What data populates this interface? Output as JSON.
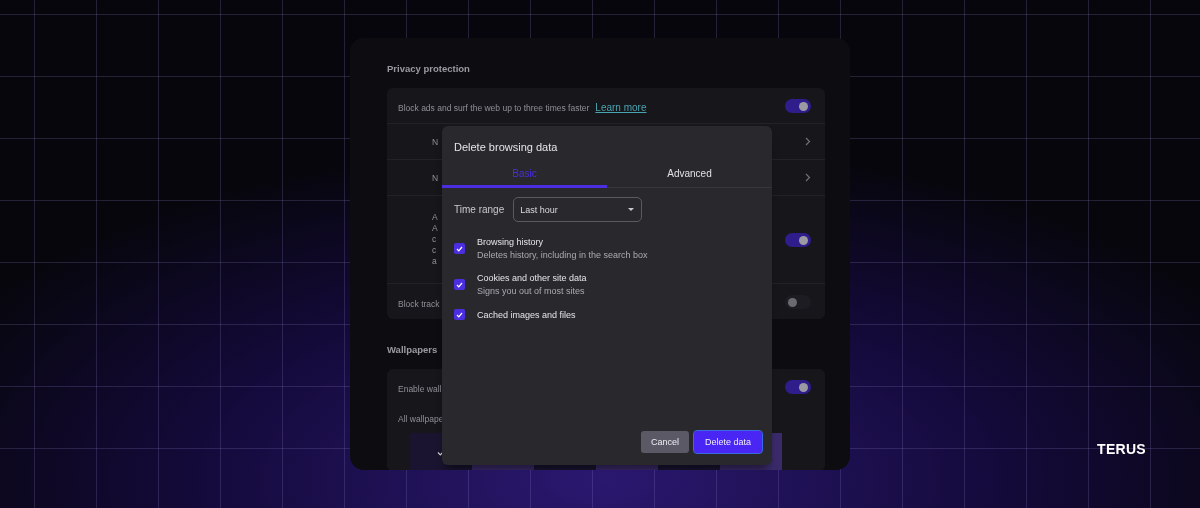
{
  "settings": {
    "sections": [
      {
        "title": "Privacy protection",
        "rows": [
          {
            "kind": "toggle",
            "label": "Block ads and surf the web up to three times faster",
            "link": "Learn more",
            "on": true
          },
          {
            "kind": "nav",
            "label": "N"
          },
          {
            "kind": "nav",
            "label": "N"
          },
          {
            "kind": "toggle",
            "lines": [
              "A",
              "A",
              "c",
              "c",
              "a"
            ],
            "on": true
          },
          {
            "kind": "toggle",
            "label": "Block track",
            "on": false
          }
        ]
      },
      {
        "title": "Wallpapers",
        "rows": [
          {
            "kind": "toggle",
            "label": "Enable wall",
            "on": true
          },
          {
            "kind": "text",
            "label": "All wallpape"
          },
          {
            "kind": "thumbnails"
          }
        ]
      }
    ]
  },
  "dialog": {
    "title": "Delete browsing data",
    "tabs": [
      {
        "label": "Basic",
        "selected": true
      },
      {
        "label": "Advanced",
        "selected": false
      }
    ],
    "time_range": {
      "label": "Time range",
      "value": "Last hour"
    },
    "options": [
      {
        "label": "Browsing history",
        "description": "Deletes history, including in the search box",
        "checked": true
      },
      {
        "label": "Cookies and other site data",
        "description": "Signs you out of most sites",
        "checked": true
      },
      {
        "label": "Cached images and files",
        "checked": true
      }
    ],
    "buttons": [
      {
        "label": "Cancel",
        "kind": "secondary"
      },
      {
        "label": "Delete data",
        "kind": "primary"
      }
    ]
  },
  "brand": "TERUS"
}
